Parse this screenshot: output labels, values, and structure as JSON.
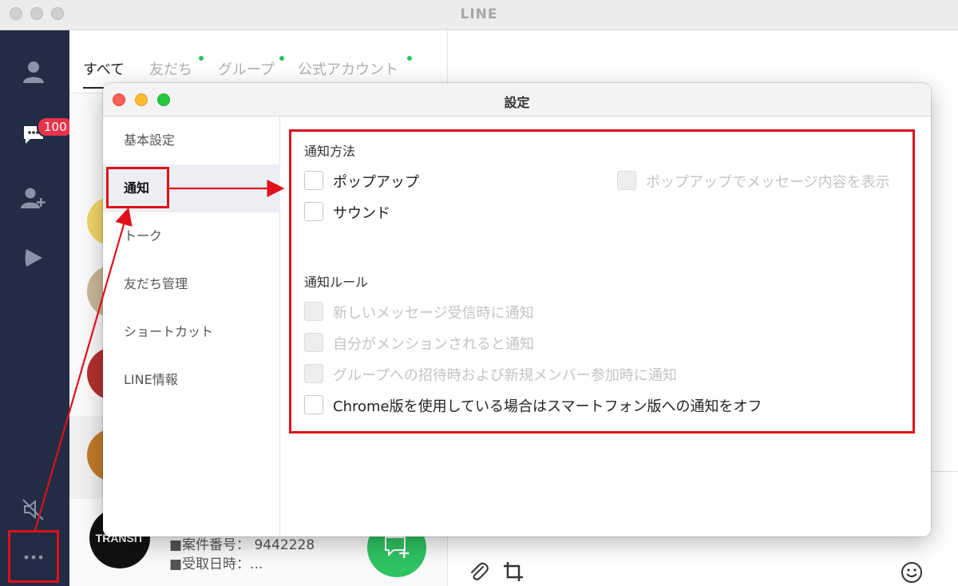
{
  "main_window": {
    "title": "LINE",
    "badge_count": "100",
    "tabs": [
      {
        "label": "すべて",
        "active": true,
        "has_dot": false
      },
      {
        "label": "友だち",
        "active": false,
        "has_dot": true
      },
      {
        "label": "グループ",
        "active": false,
        "has_dot": true
      },
      {
        "label": "公式アカウント",
        "active": false,
        "has_dot": true
      }
    ],
    "chat_preview": {
      "avatar_text": "TRANSIT",
      "line1": "■案件番号： 9442228",
      "line2": "■受取日時：..."
    },
    "sidebar_icons": [
      "person-icon",
      "chat-icon",
      "add-friend-icon",
      "play-icon",
      "mute-icon",
      "more-icon"
    ]
  },
  "settings_dialog": {
    "title": "設定",
    "menu": [
      {
        "label": "基本設定",
        "active": false
      },
      {
        "label": "通知",
        "active": true
      },
      {
        "label": "トーク",
        "active": false
      },
      {
        "label": "友だち管理",
        "active": false
      },
      {
        "label": "ショートカット",
        "active": false
      },
      {
        "label": "LINE情報",
        "active": false
      }
    ],
    "notification_method": {
      "title": "通知方法",
      "popup": {
        "label": "ポップアップ",
        "checked": false,
        "disabled": false
      },
      "sound": {
        "label": "サウンド",
        "checked": false,
        "disabled": false
      },
      "popup_preview": {
        "label": "ポップアップでメッセージ内容を表示",
        "checked": false,
        "disabled": true
      }
    },
    "notification_rules": {
      "title": "通知ルール",
      "items": [
        {
          "label": "新しいメッセージ受信時に通知",
          "checked": false,
          "disabled": true
        },
        {
          "label": "自分がメンションされると通知",
          "checked": false,
          "disabled": true
        },
        {
          "label": "グループへの招待時および新規メンバー参加時に通知",
          "checked": false,
          "disabled": true
        },
        {
          "label": "Chrome版を使用している場合はスマートフォン版への通知をオフ",
          "checked": false,
          "disabled": false
        }
      ]
    }
  },
  "colors": {
    "sidebar": "#222c45",
    "line_green": "#2ec261",
    "annotation_red": "#e0101a",
    "badge_red": "#e6344a"
  }
}
